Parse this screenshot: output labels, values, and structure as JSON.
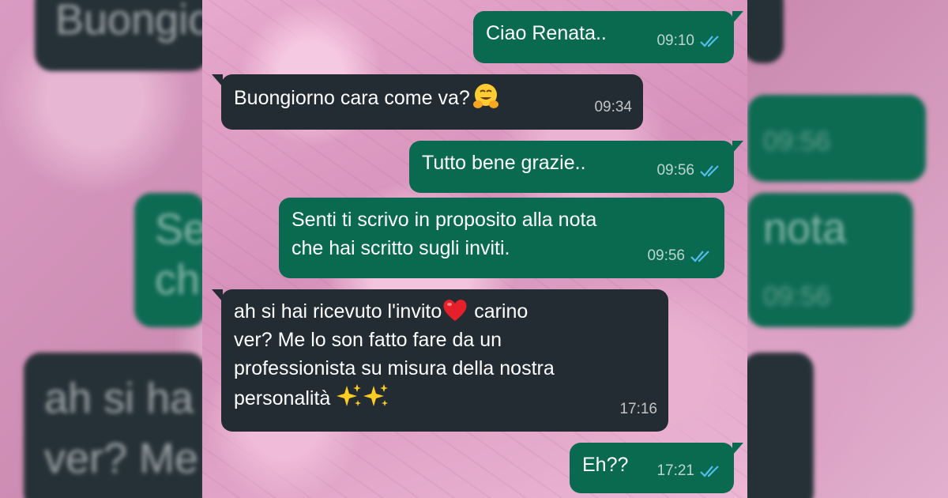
{
  "colors": {
    "incoming_bubble": "#222c32",
    "outgoing_bubble": "#0a6a4f",
    "read_ticks": "#53bdeb",
    "background": "#d99bc2"
  },
  "messages": [
    {
      "direction": "out",
      "lines": [
        "Ciao Renata.."
      ],
      "time": "09:10",
      "status": "read"
    },
    {
      "direction": "in",
      "lines": [
        "Buongiorno cara come va?"
      ],
      "emoji": "hugging-face",
      "time": "09:34"
    },
    {
      "direction": "out",
      "lines": [
        "Tutto bene grazie.."
      ],
      "time": "09:56",
      "status": "read"
    },
    {
      "direction": "out",
      "lines": [
        "Senti ti scrivo in proposito alla nota",
        "che hai scritto sugli inviti."
      ],
      "time": "09:56",
      "status": "read"
    },
    {
      "direction": "in",
      "lines": [
        "ah si hai ricevuto l'invito",
        "carino",
        "ver? Me lo son fatto fare da un",
        "professionista su misura della nostra",
        "personalità"
      ],
      "emoji": [
        "red-heart",
        "sparkles",
        "sparkles"
      ],
      "time": "17:16"
    },
    {
      "direction": "out",
      "lines": [
        "Eh??"
      ],
      "time": "17:21",
      "status": "read"
    }
  ],
  "background_ghosts": {
    "top_left": "Buongio",
    "mid_left": "Se",
    "mid_left_2": "ch",
    "right_nota": "nota",
    "right_time_1": "09:56",
    "right_time_2": "09:56",
    "bottom_left_1": "ah si ha",
    "bottom_left_2": "ver? Me"
  }
}
